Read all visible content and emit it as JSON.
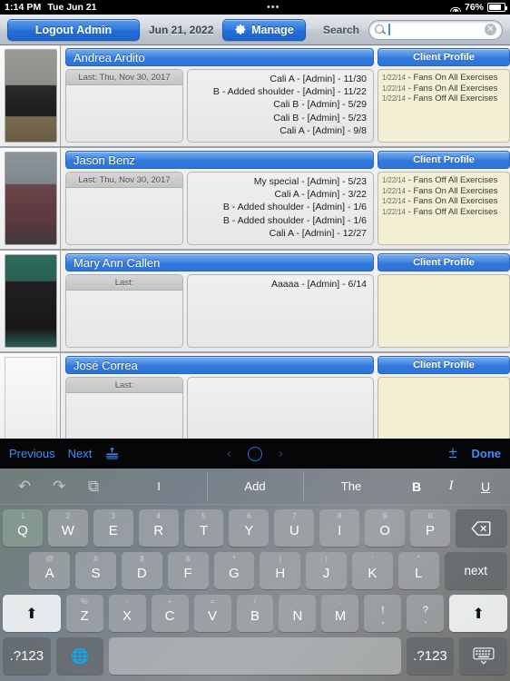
{
  "status_bar": {
    "time": "1:14 PM",
    "date": "Tue Jun 21",
    "dots": "•••",
    "wifi_icon": "wifi-icon",
    "battery_percent": "76%"
  },
  "toolbar": {
    "logout_label": "Logout Admin",
    "date_label": "Jun 21, 2022",
    "manage_label": "Manage",
    "gear_icon": "gear-icon",
    "search_label": "Search",
    "search_icon": "search-icon",
    "search_value": "",
    "search_placeholder": "",
    "clear_icon": "clear-icon",
    "accent_blue": "#2f78dd"
  },
  "clients": [
    {
      "name": "Andrea Ardito",
      "profile_label": "Client Profile",
      "last_label": "Last: Thu, Nov 30, 2017",
      "has_photo": true,
      "history": [
        "Cali A - [Admin] - 11/30",
        "B - Added shoulder - [Admin] - 11/22",
        "Cali B - [Admin] - 5/29",
        "Cali B - [Admin] - 5/23",
        "Cali A - [Admin] - 9/8"
      ],
      "notes": [
        {
          "date": "1/22/14",
          "text": "- Fans On All Exercises"
        },
        {
          "date": "1/22/14",
          "text": "- Fans On All Exercises"
        },
        {
          "date": "1/22/14",
          "text": "- Fans Off All Exercises"
        }
      ]
    },
    {
      "name": "Jason Benz",
      "profile_label": "Client Profile",
      "last_label": "Last: Thu, Nov 30, 2017",
      "has_photo": true,
      "history": [
        "My special - [Admin] - 5/23",
        "Cali A - [Admin] - 3/22",
        "B - Added shoulder - [Admin] - 1/6",
        "B - Added shoulder - [Admin] - 1/6",
        "Cali A - [Admin] - 12/27"
      ],
      "notes": [
        {
          "date": "1/22/14",
          "text": "- Fans Off All Exercises"
        },
        {
          "date": "1/22/14",
          "text": "- Fans On All Exercises"
        },
        {
          "date": "1/22/14",
          "text": "- Fans On All Exercises"
        },
        {
          "date": "1/22/14",
          "text": "- Fans Off All Exercises"
        }
      ]
    },
    {
      "name": "Mary Ann Callen",
      "profile_label": "Client Profile",
      "last_label": "Last:",
      "has_photo": true,
      "history": [
        "Aaaaa - [Admin] - 6/14"
      ],
      "notes": []
    },
    {
      "name": "José  Correa",
      "profile_label": "Client Profile",
      "last_label": "Last:",
      "has_photo": false,
      "history": [],
      "notes": []
    }
  ],
  "accessory_bar": {
    "previous_label": "Previous",
    "next_label": "Next",
    "align_icon": "align-icon",
    "prev_chevron_icon": "chevron-left-icon",
    "ring_icon": "circle-icon",
    "next_chevron_icon": "chevron-right-icon",
    "plusminus_icon": "plus-minus-icon",
    "done_label": "Done"
  },
  "keyboard": {
    "undo_icon": "undo-icon",
    "redo_icon": "redo-icon",
    "paste_icon": "paste-icon",
    "predictions": [
      "I",
      "Add",
      "The"
    ],
    "bold_label": "B",
    "italic_label": "I",
    "underline_label": "U",
    "row1": [
      {
        "sub": "1",
        "main": "Q"
      },
      {
        "sub": "2",
        "main": "W"
      },
      {
        "sub": "3",
        "main": "E"
      },
      {
        "sub": "4",
        "main": "R"
      },
      {
        "sub": "5",
        "main": "T"
      },
      {
        "sub": "6",
        "main": "Y"
      },
      {
        "sub": "7",
        "main": "U"
      },
      {
        "sub": "8",
        "main": "I"
      },
      {
        "sub": "9",
        "main": "O"
      },
      {
        "sub": "0",
        "main": "P"
      }
    ],
    "backspace_icon": "backspace-icon",
    "row2": [
      {
        "sub": "@",
        "main": "A"
      },
      {
        "sub": "#",
        "main": "S"
      },
      {
        "sub": "$",
        "main": "D"
      },
      {
        "sub": "&",
        "main": "F"
      },
      {
        "sub": "*",
        "main": "G"
      },
      {
        "sub": "(",
        "main": "H"
      },
      {
        "sub": ")",
        "main": "J"
      },
      {
        "sub": "'",
        "main": "K"
      },
      {
        "sub": "\"",
        "main": "L"
      }
    ],
    "next_key_label": "next",
    "shift_left_icon": "shift-icon",
    "row3": [
      {
        "sub": "%",
        "main": "Z"
      },
      {
        "sub": "-",
        "main": "X"
      },
      {
        "sub": "+",
        "main": "C"
      },
      {
        "sub": "=",
        "main": "V"
      },
      {
        "sub": "/",
        "main": "B"
      },
      {
        "sub": ";",
        "main": "N"
      },
      {
        "sub": ":",
        "main": "M"
      }
    ],
    "punct_keys": [
      {
        "up": "!",
        "lo": ","
      },
      {
        "up": "?",
        "lo": "."
      }
    ],
    "shift_right_icon": "shift-icon",
    "numeric_left_label": ".?123",
    "globe_icon": "globe-icon",
    "space_label": "",
    "numeric_right_label": ".?123",
    "hide_keyboard_icon": "hide-keyboard-icon"
  }
}
